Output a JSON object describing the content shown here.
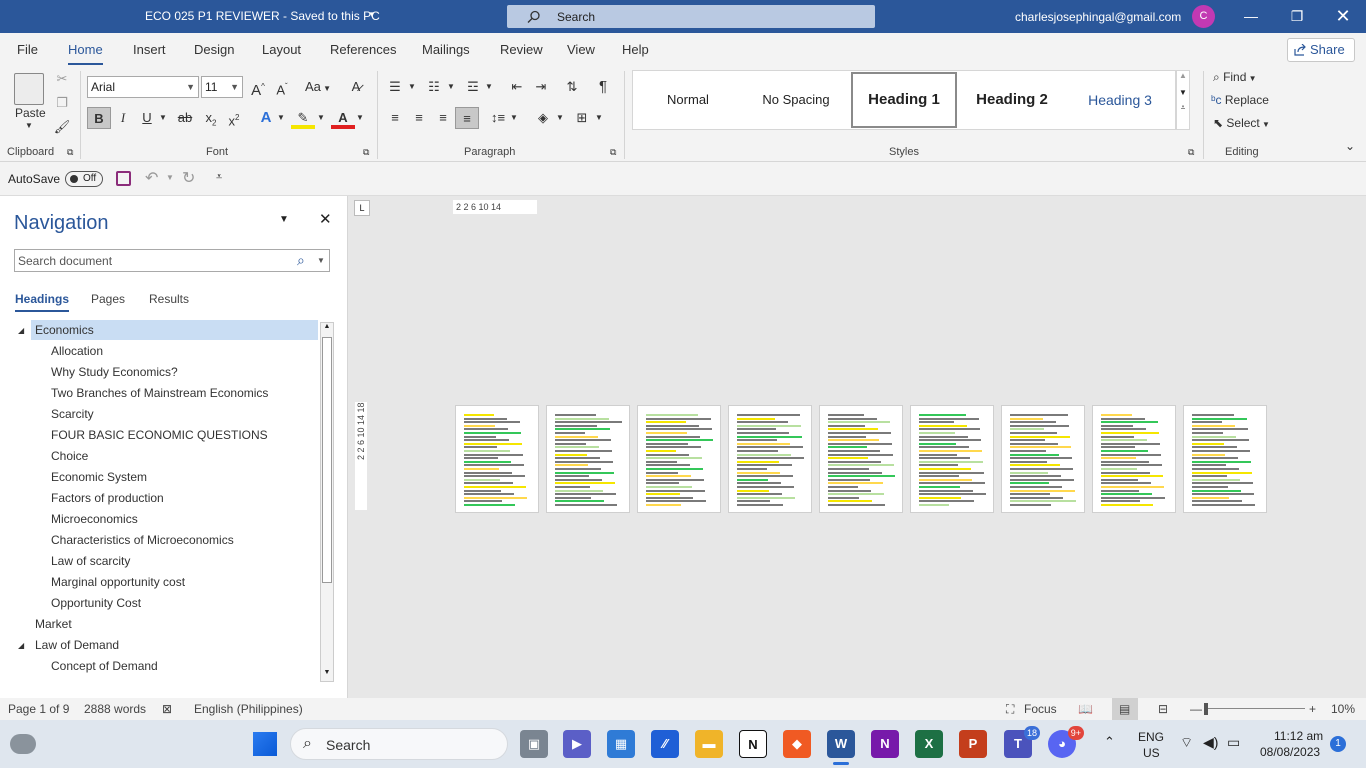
{
  "window": {
    "title": "ECO 025 P1 REVIEWER  -  Saved to this PC",
    "search_placeholder": "Search",
    "user_email": "charlesjosephingal@gmail.com",
    "user_initial": "C"
  },
  "menu": {
    "tabs": [
      "File",
      "Home",
      "Insert",
      "Design",
      "Layout",
      "References",
      "Mailings",
      "Review",
      "View",
      "Help"
    ],
    "active": "Home",
    "share_label": "Share"
  },
  "ribbon": {
    "clipboard": {
      "paste_label": "Paste",
      "group_label": "Clipboard"
    },
    "font": {
      "font_name": "Arial",
      "font_size": "11",
      "group_label": "Font",
      "case_label": "Aa"
    },
    "paragraph": {
      "group_label": "Paragraph"
    },
    "styles": {
      "items": [
        "Normal",
        "No Spacing",
        "Heading 1",
        "Heading 2",
        "Heading 3"
      ],
      "selected": "Heading 1",
      "group_label": "Styles"
    },
    "editing": {
      "find_label": "Find",
      "replace_label": "Replace",
      "select_label": "Select",
      "group_label": "Editing"
    }
  },
  "qat": {
    "autosave_label": "AutoSave",
    "autosave_state": "Off"
  },
  "navigation": {
    "title": "Navigation",
    "search_placeholder": "Search document",
    "tabs": [
      "Headings",
      "Pages",
      "Results"
    ],
    "active_tab": "Headings",
    "headings": [
      {
        "text": "Economics",
        "level": 1,
        "expanded": true,
        "selected": true
      },
      {
        "text": "Allocation",
        "level": 2
      },
      {
        "text": "Why Study Economics?",
        "level": 2
      },
      {
        "text": "Two Branches of Mainstream Economics",
        "level": 2
      },
      {
        "text": "Scarcity",
        "level": 2
      },
      {
        "text": "FOUR BASIC ECONOMIC QUESTIONS",
        "level": 2
      },
      {
        "text": "Choice",
        "level": 2
      },
      {
        "text": "Economic System",
        "level": 2
      },
      {
        "text": "Factors of production",
        "level": 2
      },
      {
        "text": "Microeconomics",
        "level": 2
      },
      {
        "text": "Characteristics of Microeconomics",
        "level": 2
      },
      {
        "text": "Law of scarcity",
        "level": 2
      },
      {
        "text": "Marginal opportunity cost",
        "level": 2
      },
      {
        "text": "Opportunity Cost",
        "level": 2
      },
      {
        "text": "Market",
        "level": 1
      },
      {
        "text": "Law of Demand",
        "level": 1,
        "expanded": true
      },
      {
        "text": "Concept of Demand",
        "level": 2
      }
    ]
  },
  "document": {
    "ruler_labels": "2  2  6  10  14",
    "vruler_labels": "2  2  6  10  14  18",
    "page_count": 9
  },
  "status": {
    "page": "Page 1 of 9",
    "words": "2888 words",
    "language": "English (Philippines)",
    "focus_label": "Focus",
    "zoom": "10%"
  },
  "taskbar": {
    "search_label": "Search",
    "teams_badge": "18",
    "discord_badge": "9+",
    "lang_top": "ENG",
    "lang_bottom": "US",
    "time": "11:12 am",
    "date": "08/08/2023",
    "notif_count": "1"
  }
}
